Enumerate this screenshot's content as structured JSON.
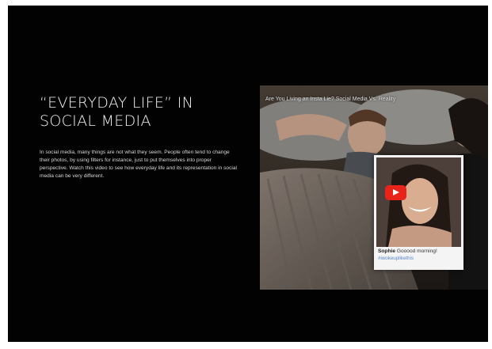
{
  "slide": {
    "heading": "“EVERYDAY LIFE” IN SOCIAL MEDIA",
    "body": "In social media, many things are not what they seem. People often tend to change their photos, by using filters for instance, just to put themselves into proper perspective. Watch this video to see how everyday life and its representation in social media can be very different."
  },
  "video": {
    "title": "Are You Living an Insta Lie? Social Media Vs. Reality",
    "play_icon": "youtube-play-icon",
    "caption_user": "Sophie",
    "caption_text": "Gooood morning!",
    "caption_hashtag": "#iwokeuplikethis"
  },
  "colors": {
    "slide_background": "#020202",
    "play_button": "#e8231a",
    "hashtag": "#5d86c9"
  }
}
